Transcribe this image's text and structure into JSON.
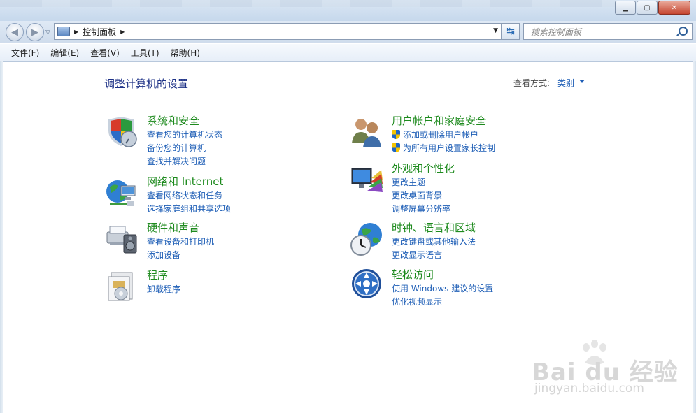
{
  "window": {
    "minimize_glyph": "▁",
    "restore_glyph": "▢",
    "close_glyph": "✕"
  },
  "nav": {
    "back_glyph": "◀",
    "forward_glyph": "▶",
    "history_glyph": "▽",
    "breadcrumb": "控制面板",
    "breadcrumb_arrow": "▶",
    "addr_dropdown_glyph": "▼",
    "refresh_glyph": "↹"
  },
  "search": {
    "placeholder": "搜索控制面板"
  },
  "menu": [
    "文件(F)",
    "编辑(E)",
    "查看(V)",
    "工具(T)",
    "帮助(H)"
  ],
  "main": {
    "title": "调整计算机的设置",
    "view_by_label": "查看方式:",
    "view_by_value": "类别",
    "left_categories": [
      {
        "title": "系统和安全",
        "links": [
          "查看您的计算机状态",
          "备份您的计算机",
          "查找并解决问题"
        ],
        "icon": "system-security-icon"
      },
      {
        "title": "网络和 Internet",
        "links": [
          "查看网络状态和任务",
          "选择家庭组和共享选项"
        ],
        "icon": "network-icon"
      },
      {
        "title": "硬件和声音",
        "links": [
          "查看设备和打印机",
          "添加设备"
        ],
        "icon": "hardware-sound-icon"
      },
      {
        "title": "程序",
        "links": [
          "卸载程序"
        ],
        "icon": "programs-icon"
      }
    ],
    "right_categories": [
      {
        "title": "用户帐户和家庭安全",
        "links": [
          "添加或删除用户帐户",
          "为所有用户设置家长控制"
        ],
        "shields": true,
        "icon": "user-accounts-icon"
      },
      {
        "title": "外观和个性化",
        "links": [
          "更改主题",
          "更改桌面背景",
          "调整屏幕分辨率"
        ],
        "icon": "appearance-icon"
      },
      {
        "title": "时钟、语言和区域",
        "links": [
          "更改键盘或其他输入法",
          "更改显示语言"
        ],
        "icon": "clock-language-icon"
      },
      {
        "title": "轻松访问",
        "links": [
          "使用 Windows 建议的设置",
          "优化视频显示"
        ],
        "icon": "ease-of-access-icon"
      }
    ]
  },
  "watermark": {
    "logo": "Bai du 经验",
    "url": "jingyan.baidu.com"
  }
}
